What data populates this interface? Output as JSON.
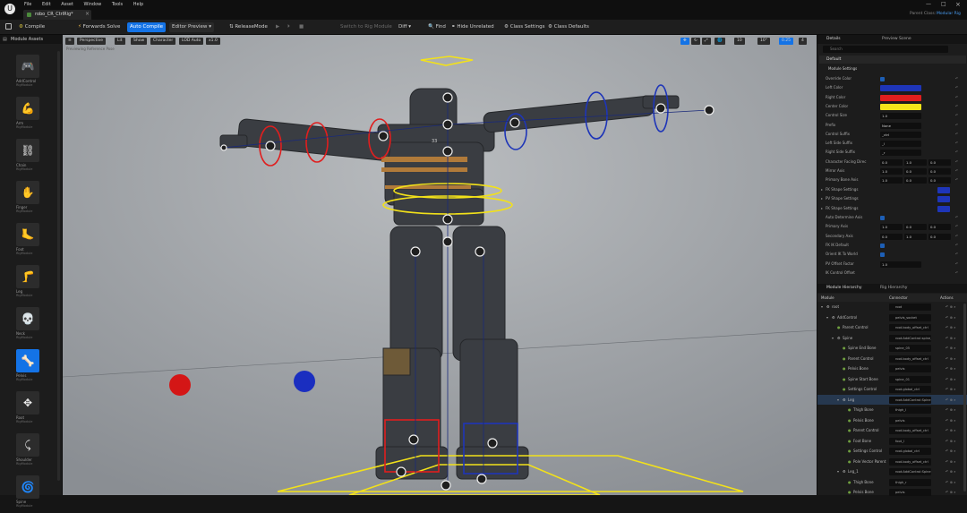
{
  "window": {
    "tab_title": "robo_CR_CtrlRig*",
    "top_right": [
      "Parent Class:",
      "Modular Rig"
    ],
    "menu": [
      "File",
      "Edit",
      "Asset",
      "Window",
      "Tools",
      "Help"
    ]
  },
  "toolbar": {
    "compile": "Compile",
    "forwards_solve": "Forwards Solve",
    "auto_compile": "Auto Compile",
    "editor_preview": "Editor Preview",
    "release_mode": "ReleaseMode",
    "switch_to_rig_module": "Switch to Rig Module",
    "diff": "Diff",
    "find": "Find",
    "hide_unrelated": "Hide Unrelated",
    "class_settings": "Class Settings",
    "class_defaults": "Class Defaults"
  },
  "left_panel": {
    "title": "Module Assets",
    "assets": [
      {
        "label": "AddControl",
        "sub": "RigModule",
        "icon": "🎮"
      },
      {
        "label": "Arm",
        "sub": "RigModule",
        "icon": "💪"
      },
      {
        "label": "Chain",
        "sub": "RigModule",
        "icon": "⛓"
      },
      {
        "label": "Finger",
        "sub": "RigModule",
        "icon": "✋"
      },
      {
        "label": "Foot",
        "sub": "RigModule",
        "icon": "🦶"
      },
      {
        "label": "Leg",
        "sub": "RigModule",
        "icon": "🦵"
      },
      {
        "label": "Neck",
        "sub": "RigModule",
        "icon": "💀"
      },
      {
        "label": "Pelvis",
        "sub": "RigModule",
        "icon": "🦴"
      },
      {
        "label": "Root",
        "sub": "RigModule",
        "icon": "✥"
      },
      {
        "label": "Shoulder",
        "sub": "RigModule",
        "icon": "⤹"
      },
      {
        "label": "Spine",
        "sub": "RigModule",
        "icon": "🌀"
      }
    ]
  },
  "viewport": {
    "buttons": [
      "Perspective",
      "Lit",
      "Show",
      "Character",
      "LOD Auto",
      "x1.0"
    ],
    "right_buttons": [
      "10",
      "10°",
      "0.25",
      "4"
    ],
    "label": "Previewing Reference Pose"
  },
  "details": {
    "tabs": [
      "Details",
      "Preview Scene"
    ],
    "search_placeholder": "Search",
    "section": "Default",
    "group": "Module Settings",
    "rows": [
      {
        "name": "Override Color",
        "type": "check"
      },
      {
        "name": "Left Color",
        "type": "color",
        "color": "#1e35b8"
      },
      {
        "name": "Right Color",
        "type": "color",
        "color": "#e01e1e"
      },
      {
        "name": "Center Color",
        "type": "color",
        "color": "#f4e419"
      },
      {
        "name": "Control Size",
        "type": "text",
        "value": "1.0"
      },
      {
        "name": "Prefix",
        "type": "text",
        "value": "None"
      },
      {
        "name": "Control Suffix",
        "type": "text",
        "value": "_ctrl"
      },
      {
        "name": "Left Side Suffix",
        "type": "text",
        "value": "_l"
      },
      {
        "name": "Right Side Suffix",
        "type": "text",
        "value": "_r"
      },
      {
        "name": "Character Facing Direc",
        "type": "vec",
        "values": [
          "0.0",
          "1.0",
          "0.0"
        ]
      },
      {
        "name": "Mirror Axis",
        "type": "vec",
        "values": [
          "1.0",
          "0.0",
          "0.0"
        ]
      },
      {
        "name": "Primary Bone Axis",
        "type": "vec",
        "values": [
          "1.0",
          "0.0",
          "0.0"
        ]
      }
    ],
    "groups2": [
      "FK Shape Settings",
      "PV Shape Settings",
      "FK Shape Settings"
    ],
    "rows2": [
      {
        "name": "Auto Determine Axis",
        "type": "check"
      },
      {
        "name": "Primary Axis",
        "type": "vec",
        "values": [
          "1.0",
          "0.0",
          "0.0"
        ]
      },
      {
        "name": "Secondary Axis",
        "type": "vec",
        "values": [
          "0.0",
          "1.0",
          "0.0"
        ]
      },
      {
        "name": "FK IK Default",
        "type": "check"
      },
      {
        "name": "Orient IK To World",
        "type": "check"
      },
      {
        "name": "PV Offset Factor",
        "type": "text",
        "value": "1.0"
      },
      {
        "name": "IK Control Offset",
        "type": "none"
      }
    ]
  },
  "hierarchy": {
    "tabs": [
      "Module Hierarchy",
      "Rig Hierarchy"
    ],
    "columns": [
      "Module",
      "Connector",
      "Actions"
    ],
    "rows": [
      {
        "name": "root",
        "connector": "root",
        "indent": 0,
        "kind": "module"
      },
      {
        "name": "AddControl",
        "connector": "pelvis_socket",
        "indent": 1,
        "kind": "module"
      },
      {
        "name": "Parent Control",
        "connector": "root.body_offset_ctrl",
        "indent": 2,
        "kind": "conn"
      },
      {
        "name": "Spine",
        "connector": "root:AddControl:spine_socket",
        "indent": 2,
        "kind": "module"
      },
      {
        "name": "Spine End Bone",
        "connector": "spine_05",
        "indent": 3,
        "kind": "conn"
      },
      {
        "name": "Parent Control",
        "connector": "root.body_offset_ctrl",
        "indent": 3,
        "kind": "conn"
      },
      {
        "name": "Pelvis Bone",
        "connector": "pelvis",
        "indent": 3,
        "kind": "conn"
      },
      {
        "name": "Spine Start Bone",
        "connector": "spine_01",
        "indent": 3,
        "kind": "conn"
      },
      {
        "name": "Settings Control",
        "connector": "root.global_ctrl",
        "indent": 3,
        "kind": "conn"
      },
      {
        "name": "Leg",
        "connector": "root:AddControl:Spine:leg",
        "indent": 3,
        "kind": "module",
        "selected": true
      },
      {
        "name": "Thigh Bone",
        "connector": "thigh_l",
        "indent": 4,
        "kind": "conn"
      },
      {
        "name": "Pelvis Bone",
        "connector": "pelvis",
        "indent": 4,
        "kind": "conn"
      },
      {
        "name": "Parent Control",
        "connector": "root.body_offset_ctrl",
        "indent": 4,
        "kind": "conn"
      },
      {
        "name": "Foot Bone",
        "connector": "foot_l",
        "indent": 4,
        "kind": "conn"
      },
      {
        "name": "Settings Control",
        "connector": "root.global_ctrl",
        "indent": 4,
        "kind": "conn"
      },
      {
        "name": "Pole Vector Parent",
        "connector": "root.body_offset_ctrl",
        "indent": 4,
        "kind": "conn"
      },
      {
        "name": "Leg_1",
        "connector": "root:AddControl:Spine:leg",
        "indent": 3,
        "kind": "module"
      },
      {
        "name": "Thigh Bone",
        "connector": "thigh_r",
        "indent": 4,
        "kind": "conn"
      },
      {
        "name": "Pelvis Bone",
        "connector": "pelvis",
        "indent": 4,
        "kind": "conn"
      }
    ]
  }
}
